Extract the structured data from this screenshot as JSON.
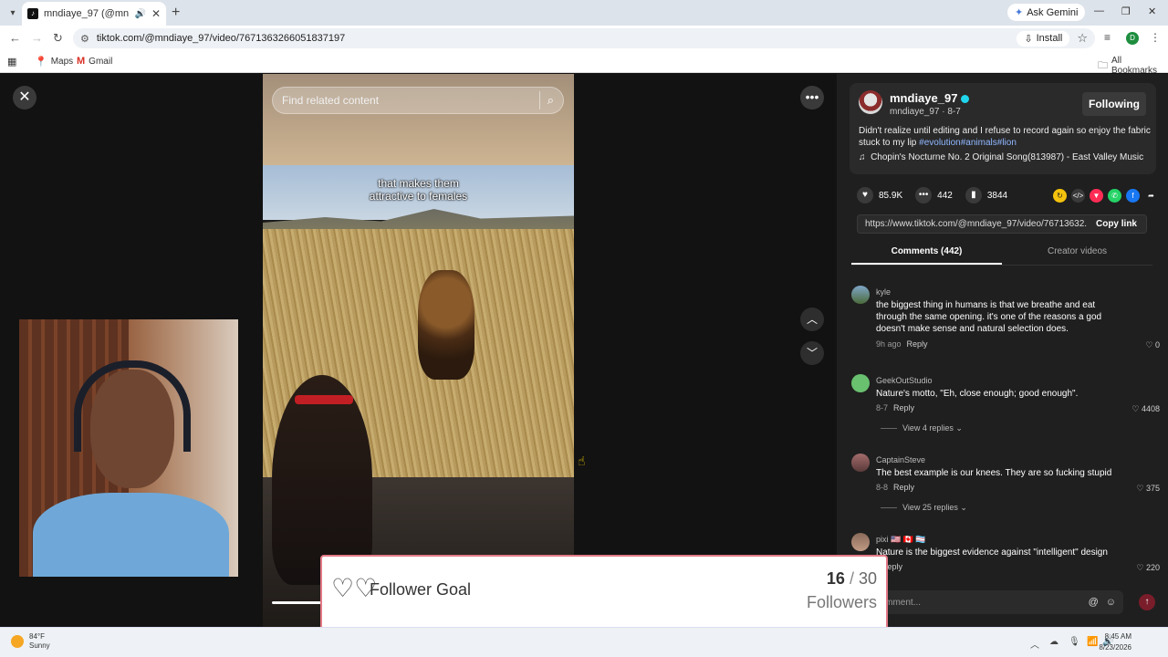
{
  "browser": {
    "tab_title": "mndiaye_97 (@mndiaye_97",
    "url": "tiktok.com/@mndiaye_97/video/7671363266051837197",
    "install_label": "Install",
    "gemini_label": "Ask Gemini",
    "bookmarks": [
      {
        "label": "Maps"
      },
      {
        "label": "Gmail"
      }
    ],
    "all_bookmarks_label": "All Bookmarks",
    "profile_initial": "D"
  },
  "video": {
    "search_placeholder": "Find related content",
    "caption_line1": "that makes them",
    "caption_line2": "attractive to females"
  },
  "author": {
    "username": "mndiaye_97",
    "handle_date": "mndiaye_97 · 8-7",
    "follow_label": "Following",
    "description": "Didn't realize until editing and I refuse to record again so enjoy the fabric stuck to my lip ",
    "hashtags": "#evolution#animals#lion",
    "music": "Chopin's Nocturne No. 2 Original Song(813987) - East Valley Music"
  },
  "stats": {
    "likes": "85.9K",
    "comments": "442",
    "saves": "3844"
  },
  "share_link": {
    "url": "https://www.tiktok.com/@mndiaye_97/video/76713632...",
    "copy_label": "Copy link"
  },
  "tabs": {
    "comments": "Comments (442)",
    "creator_videos": "Creator videos"
  },
  "comments": [
    {
      "user": "kyle",
      "text": "the biggest thing in humans is that we breathe and eat through the same opening. it's one of the reasons a god doesn't make sense and natural selection does.",
      "time": "9h ago",
      "reply": "Reply",
      "likes": "0"
    },
    {
      "user": "GeekOutStudio",
      "text": "Nature's motto, \"Eh, close enough; good enough\".",
      "time": "8-7",
      "reply": "Reply",
      "likes": "4408",
      "view_replies": "View 4 replies"
    },
    {
      "user": "CaptainSteve",
      "text": "The best example is our knees. They are so fucking stupid",
      "time": "8-8",
      "reply": "Reply",
      "likes": "375",
      "view_replies": "View 25 replies"
    },
    {
      "user": "pixi 🇺🇸 🇨🇦 🏳️‍⚧️",
      "text": "Nature is the biggest evidence against \"intelligent\" design",
      "time": "",
      "reply": "Reply",
      "likes": "220"
    }
  ],
  "comment_input": {
    "placeholder": "Add comment..."
  },
  "follower_goal": {
    "title": "Follower Goal",
    "current": "16",
    "separator": "/",
    "target": "30",
    "unit": "Followers",
    "progress_fraction": 0.5333
  },
  "taskbar": {
    "temperature": "84°F",
    "condition": "Sunny",
    "time": "8:45 AM",
    "date": "8/23/2026"
  },
  "colors": {
    "goal_fill": "#e05a67",
    "link_blue": "#8fb7ff",
    "verified": "#20d5ec"
  }
}
